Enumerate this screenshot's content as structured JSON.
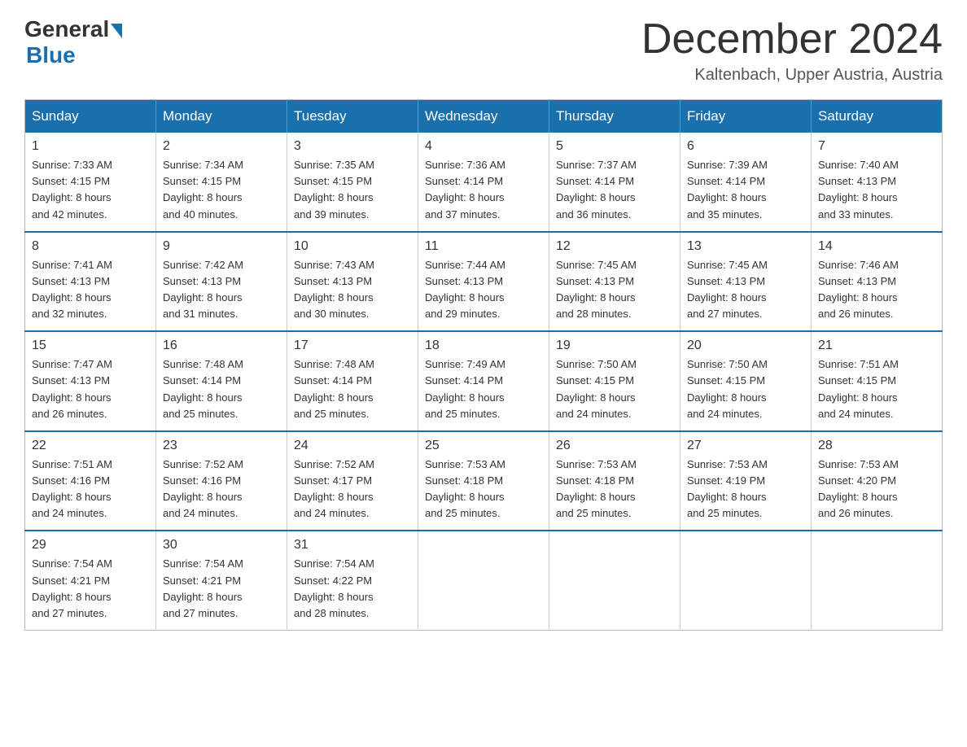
{
  "header": {
    "logo_general": "General",
    "logo_blue": "Blue",
    "month_title": "December 2024",
    "location": "Kaltenbach, Upper Austria, Austria"
  },
  "days_of_week": [
    "Sunday",
    "Monday",
    "Tuesday",
    "Wednesday",
    "Thursday",
    "Friday",
    "Saturday"
  ],
  "weeks": [
    [
      {
        "day": "1",
        "sunrise": "7:33 AM",
        "sunset": "4:15 PM",
        "daylight": "8 hours and 42 minutes."
      },
      {
        "day": "2",
        "sunrise": "7:34 AM",
        "sunset": "4:15 PM",
        "daylight": "8 hours and 40 minutes."
      },
      {
        "day": "3",
        "sunrise": "7:35 AM",
        "sunset": "4:15 PM",
        "daylight": "8 hours and 39 minutes."
      },
      {
        "day": "4",
        "sunrise": "7:36 AM",
        "sunset": "4:14 PM",
        "daylight": "8 hours and 37 minutes."
      },
      {
        "day": "5",
        "sunrise": "7:37 AM",
        "sunset": "4:14 PM",
        "daylight": "8 hours and 36 minutes."
      },
      {
        "day": "6",
        "sunrise": "7:39 AM",
        "sunset": "4:14 PM",
        "daylight": "8 hours and 35 minutes."
      },
      {
        "day": "7",
        "sunrise": "7:40 AM",
        "sunset": "4:13 PM",
        "daylight": "8 hours and 33 minutes."
      }
    ],
    [
      {
        "day": "8",
        "sunrise": "7:41 AM",
        "sunset": "4:13 PM",
        "daylight": "8 hours and 32 minutes."
      },
      {
        "day": "9",
        "sunrise": "7:42 AM",
        "sunset": "4:13 PM",
        "daylight": "8 hours and 31 minutes."
      },
      {
        "day": "10",
        "sunrise": "7:43 AM",
        "sunset": "4:13 PM",
        "daylight": "8 hours and 30 minutes."
      },
      {
        "day": "11",
        "sunrise": "7:44 AM",
        "sunset": "4:13 PM",
        "daylight": "8 hours and 29 minutes."
      },
      {
        "day": "12",
        "sunrise": "7:45 AM",
        "sunset": "4:13 PM",
        "daylight": "8 hours and 28 minutes."
      },
      {
        "day": "13",
        "sunrise": "7:45 AM",
        "sunset": "4:13 PM",
        "daylight": "8 hours and 27 minutes."
      },
      {
        "day": "14",
        "sunrise": "7:46 AM",
        "sunset": "4:13 PM",
        "daylight": "8 hours and 26 minutes."
      }
    ],
    [
      {
        "day": "15",
        "sunrise": "7:47 AM",
        "sunset": "4:13 PM",
        "daylight": "8 hours and 26 minutes."
      },
      {
        "day": "16",
        "sunrise": "7:48 AM",
        "sunset": "4:14 PM",
        "daylight": "8 hours and 25 minutes."
      },
      {
        "day": "17",
        "sunrise": "7:48 AM",
        "sunset": "4:14 PM",
        "daylight": "8 hours and 25 minutes."
      },
      {
        "day": "18",
        "sunrise": "7:49 AM",
        "sunset": "4:14 PM",
        "daylight": "8 hours and 25 minutes."
      },
      {
        "day": "19",
        "sunrise": "7:50 AM",
        "sunset": "4:15 PM",
        "daylight": "8 hours and 24 minutes."
      },
      {
        "day": "20",
        "sunrise": "7:50 AM",
        "sunset": "4:15 PM",
        "daylight": "8 hours and 24 minutes."
      },
      {
        "day": "21",
        "sunrise": "7:51 AM",
        "sunset": "4:15 PM",
        "daylight": "8 hours and 24 minutes."
      }
    ],
    [
      {
        "day": "22",
        "sunrise": "7:51 AM",
        "sunset": "4:16 PM",
        "daylight": "8 hours and 24 minutes."
      },
      {
        "day": "23",
        "sunrise": "7:52 AM",
        "sunset": "4:16 PM",
        "daylight": "8 hours and 24 minutes."
      },
      {
        "day": "24",
        "sunrise": "7:52 AM",
        "sunset": "4:17 PM",
        "daylight": "8 hours and 24 minutes."
      },
      {
        "day": "25",
        "sunrise": "7:53 AM",
        "sunset": "4:18 PM",
        "daylight": "8 hours and 25 minutes."
      },
      {
        "day": "26",
        "sunrise": "7:53 AM",
        "sunset": "4:18 PM",
        "daylight": "8 hours and 25 minutes."
      },
      {
        "day": "27",
        "sunrise": "7:53 AM",
        "sunset": "4:19 PM",
        "daylight": "8 hours and 25 minutes."
      },
      {
        "day": "28",
        "sunrise": "7:53 AM",
        "sunset": "4:20 PM",
        "daylight": "8 hours and 26 minutes."
      }
    ],
    [
      {
        "day": "29",
        "sunrise": "7:54 AM",
        "sunset": "4:21 PM",
        "daylight": "8 hours and 27 minutes."
      },
      {
        "day": "30",
        "sunrise": "7:54 AM",
        "sunset": "4:21 PM",
        "daylight": "8 hours and 27 minutes."
      },
      {
        "day": "31",
        "sunrise": "7:54 AM",
        "sunset": "4:22 PM",
        "daylight": "8 hours and 28 minutes."
      },
      null,
      null,
      null,
      null
    ]
  ],
  "labels": {
    "sunrise": "Sunrise:",
    "sunset": "Sunset:",
    "daylight": "Daylight:"
  }
}
